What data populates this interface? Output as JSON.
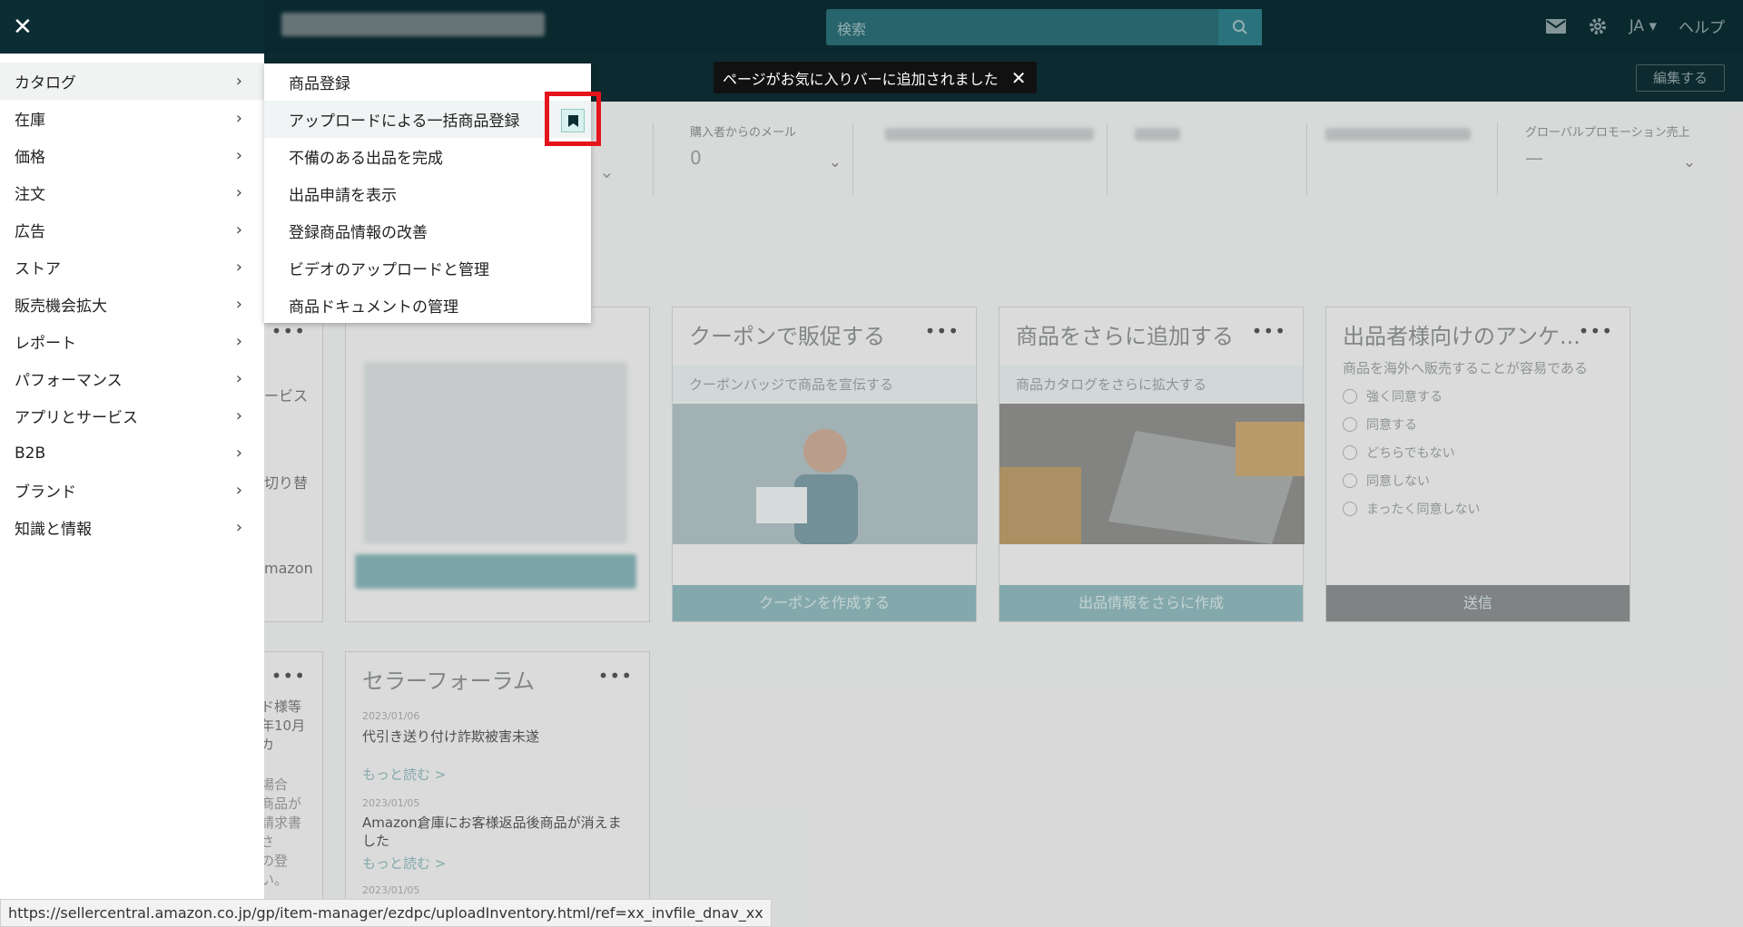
{
  "header": {
    "search_placeholder": "検索",
    "lang": "JA ▾",
    "help": "ヘルプ",
    "edit_button": "編集する"
  },
  "metrics": [
    {
      "label": "購入者からのメール",
      "value": "0"
    },
    {
      "label": "グローバルプロモーション売上",
      "value": "—"
    }
  ],
  "cards": {
    "coupon": {
      "title": "クーポンで販促する",
      "sub": "クーポンバッジで商品を宣伝する",
      "cta": "クーポンを作成する"
    },
    "add_products": {
      "title": "商品をさらに追加する",
      "sub": "商品カタログをさらに拡大する",
      "cta": "出品情報をさらに作成"
    },
    "survey": {
      "title": "出品者様向けのアンケ...",
      "question": "商品を海外へ販売することが容易である",
      "options": [
        "強く同意する",
        "同意する",
        "どちらでもない",
        "同意しない",
        "まったく同意しない"
      ],
      "cta": "送信"
    },
    "forum": {
      "title": "セラーフォーラム",
      "posts": [
        {
          "date": "2023/01/06",
          "title": "代引き送り付け詐欺被害未遂",
          "more": "もっと読む >"
        },
        {
          "date": "2023/01/05",
          "title": "Amazon倉庫にお客様返品後商品が消えました",
          "more": "もっと読む >"
        },
        {
          "date": "2023/01/05"
        }
      ]
    },
    "partial_left": {
      "text1": "ービス",
      "text2": "切り替",
      "text3": "mazon",
      "text4": "ド様等\n年10月\nカ",
      "text5": "場合\n商品が\n請求書\nさ\nの登\nい。"
    }
  },
  "nav": {
    "items": [
      {
        "label": "カタログ"
      },
      {
        "label": "在庫"
      },
      {
        "label": "価格"
      },
      {
        "label": "注文"
      },
      {
        "label": "広告"
      },
      {
        "label": "ストア"
      },
      {
        "label": "販売機会拡大"
      },
      {
        "label": "レポート"
      },
      {
        "label": "パフォーマンス"
      },
      {
        "label": "アプリとサービス"
      },
      {
        "label": "B2B"
      },
      {
        "label": "ブランド"
      },
      {
        "label": "知識と情報"
      }
    ]
  },
  "submenu": {
    "items": [
      {
        "label": "商品登録"
      },
      {
        "label": "アップロードによる一括商品登録"
      },
      {
        "label": "不備のある出品を完成"
      },
      {
        "label": "出品申請を表示"
      },
      {
        "label": "登録商品情報の改善"
      },
      {
        "label": "ビデオのアップロードと管理"
      },
      {
        "label": "商品ドキュメントの管理"
      }
    ]
  },
  "toast": {
    "message": "ページがお気に入りバーに追加されました"
  },
  "status_url": "https://sellercentral.amazon.co.jp/gp/item-manager/ezdpc/uploadInventory.html/ref=xx_invfile_dnav_xx",
  "colors": {
    "header_bg": "#0b2d33",
    "highlight": "#e5141c",
    "bookmark": "#d9f1ef"
  }
}
